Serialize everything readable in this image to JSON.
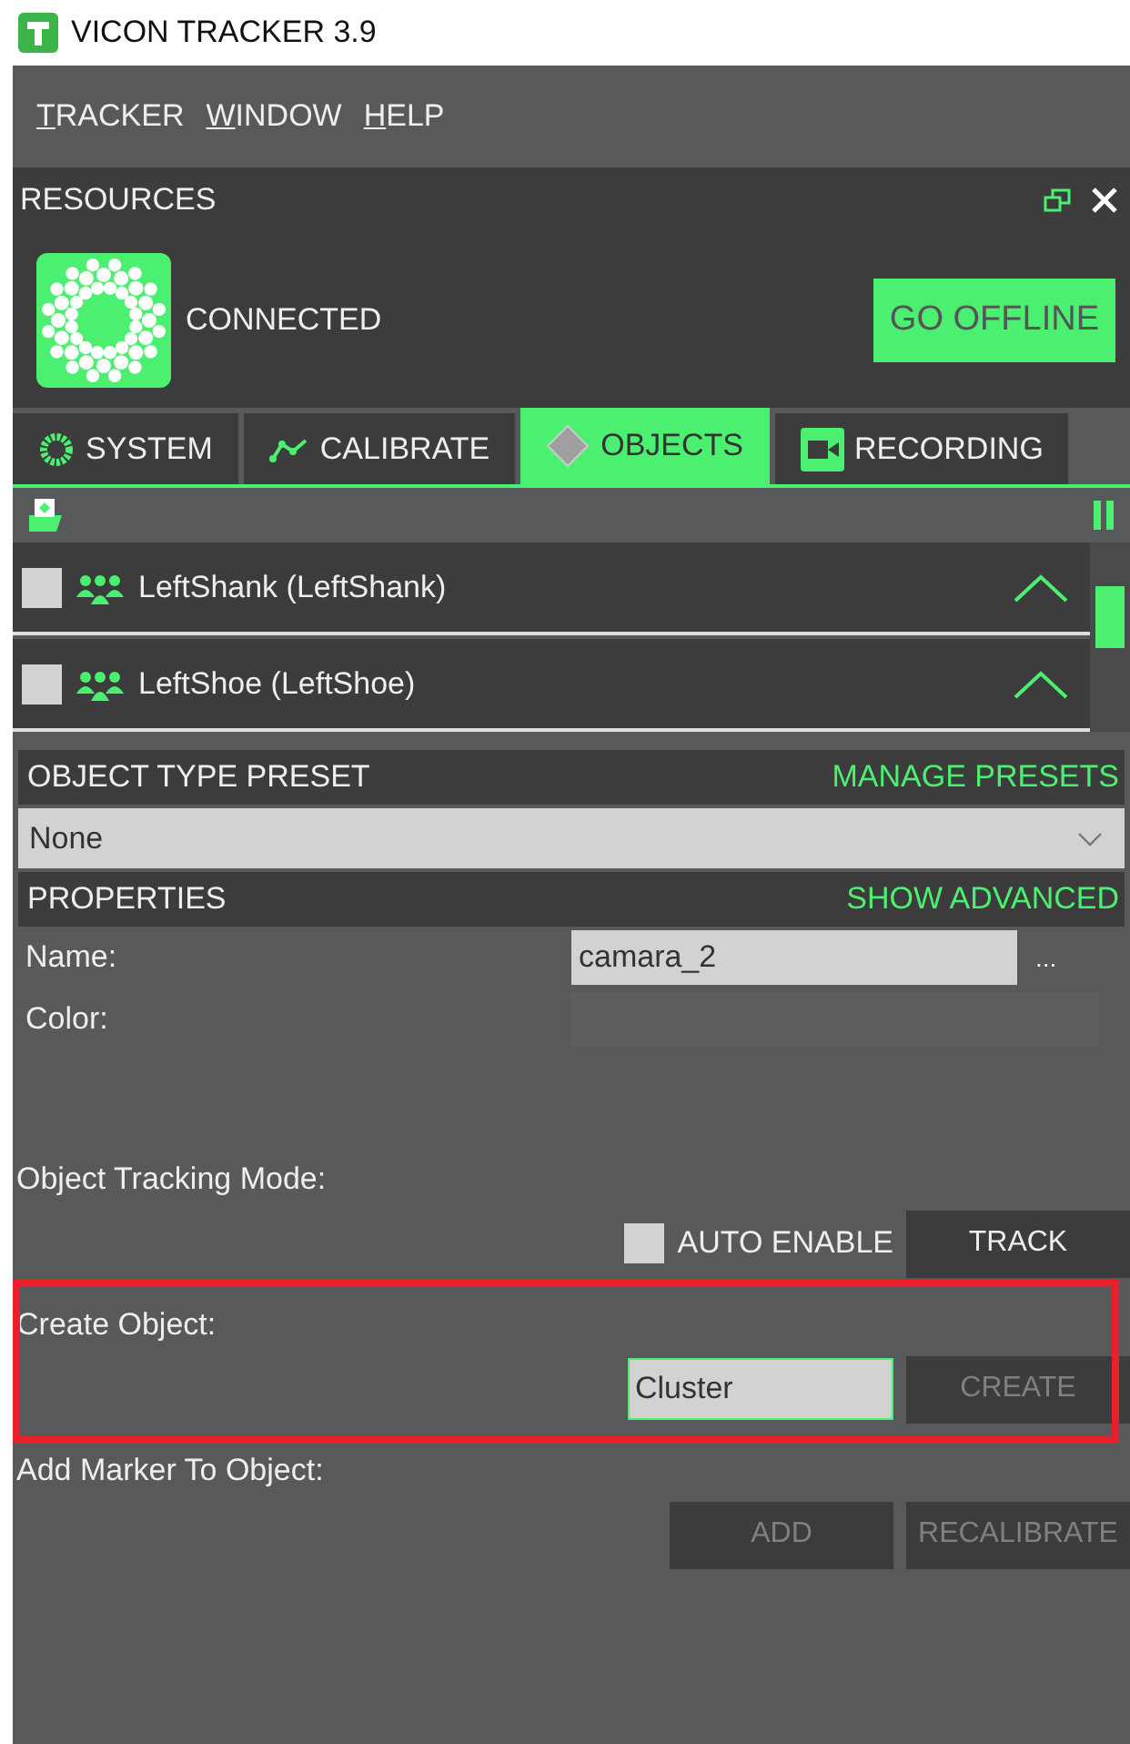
{
  "window": {
    "title": "VICON TRACKER 3.9"
  },
  "menu": [
    {
      "label": "TRACKER"
    },
    {
      "label": "WINDOW"
    },
    {
      "label": "HELP"
    }
  ],
  "resources": {
    "title": "RESOURCES",
    "status": "CONNECTED",
    "button": "GO OFFLINE"
  },
  "tabs": [
    {
      "label": "SYSTEM",
      "kind": "system",
      "selected": false
    },
    {
      "label": "CALIBRATE",
      "kind": "calibrate",
      "selected": false
    },
    {
      "label": "OBJECTS",
      "kind": "objects",
      "selected": true
    },
    {
      "label": "RECORDING",
      "kind": "recording",
      "selected": false
    }
  ],
  "objects": [
    {
      "name": "LeftShank (LeftShank)",
      "checked": false,
      "expanded": true
    },
    {
      "name": "LeftShoe (LeftShoe)",
      "checked": false,
      "expanded": true
    }
  ],
  "preset": {
    "title": "OBJECT TYPE PRESET",
    "link": "MANAGE PRESETS",
    "value": "None"
  },
  "properties": {
    "title": "PROPERTIES",
    "link": "SHOW ADVANCED",
    "fields": [
      {
        "label": "Name:",
        "kind": "text",
        "value": "camara_2",
        "more": "..."
      },
      {
        "label": "Color:",
        "kind": "color"
      }
    ]
  },
  "tracking": {
    "label": "Object Tracking Mode:",
    "checkbox": {
      "label": "AUTO ENABLE",
      "checked": false
    },
    "button": {
      "label": "TRACK",
      "disabled": false
    }
  },
  "create": {
    "label": "Create Object:",
    "value": "Cluster",
    "focused": true,
    "button": {
      "label": "CREATE",
      "disabled": true
    },
    "highlighted": true
  },
  "add_marker": {
    "label": "Add Marker To Object:",
    "buttons": [
      {
        "label": "ADD",
        "disabled": true
      },
      {
        "label": "RECALIBRATE",
        "disabled": true
      }
    ]
  }
}
